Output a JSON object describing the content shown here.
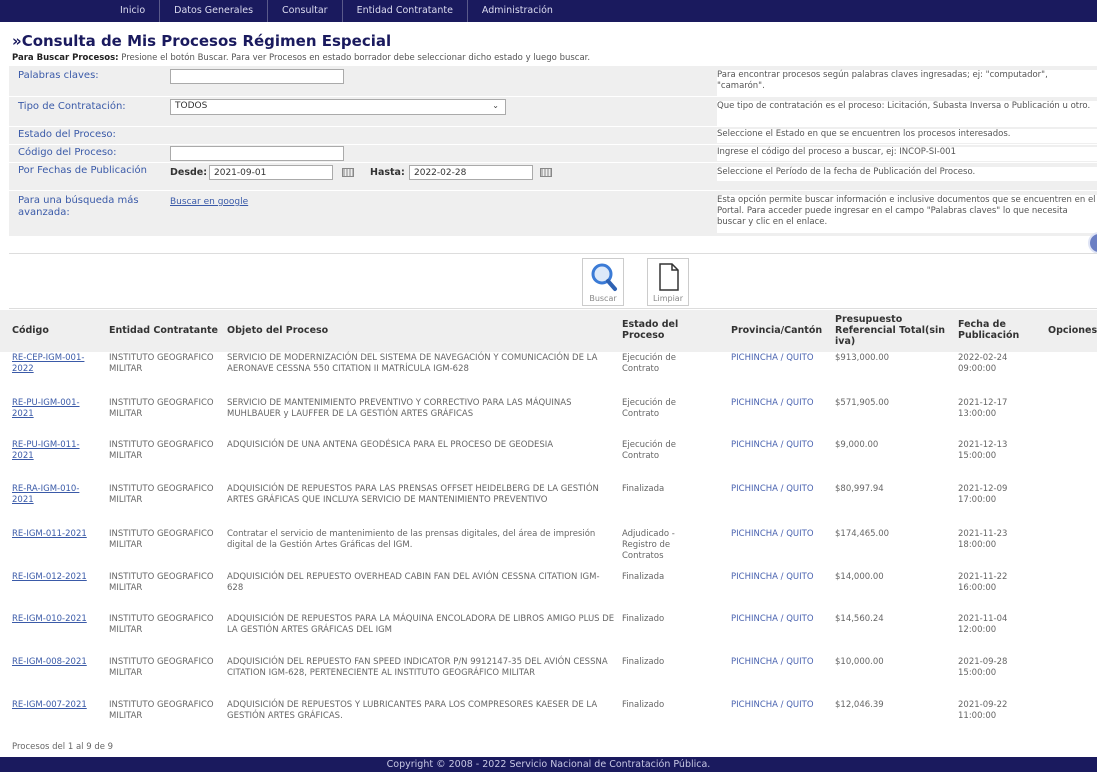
{
  "nav": {
    "items": [
      "Inicio",
      "Datos Generales",
      "Consultar",
      "Entidad Contratante",
      "Administración"
    ]
  },
  "page": {
    "title": "»Consulta de Mis Procesos Régimen Especial",
    "instructions_bold": "Para Buscar Procesos:",
    "instructions_rest": " Presione el botón Buscar. Para ver Procesos en estado borrador debe seleccionar dicho estado y luego buscar."
  },
  "form": {
    "keywords": {
      "label": "Palabras claves:",
      "value": "",
      "help": "Para encontrar procesos según palabras claves ingresadas; ej: \"computador\", \"camarón\"."
    },
    "contract_type": {
      "label": "Tipo de Contratación:",
      "selected": "TODOS",
      "help": "Que tipo de contratación es el proceso: Licitación, Subasta Inversa o Publicación u otro."
    },
    "status": {
      "label": "Estado del Proceso:",
      "help": "Seleccione el Estado en que se encuentren los procesos interesados."
    },
    "code": {
      "label": "Código del Proceso:",
      "value": "",
      "help": "Ingrese el código del proceso a buscar, ej: INCOP-SI-001"
    },
    "dates": {
      "label": "Por Fechas de Publicación",
      "from_label": "Desde:",
      "from_value": "2021-09-01",
      "to_label": "Hasta:",
      "to_value": "2022-02-28",
      "help": "Seleccione el Período de la fecha de Publicación del Proceso."
    },
    "advanced": {
      "label": "Para una búsqueda más avanzada:",
      "link": "Buscar en google",
      "help": "Esta opción permite buscar información e inclusive documentos que se encuentren en el Portal. Para acceder puede ingresar en el campo \"Palabras claves\" lo que necesita buscar y clic en el enlace."
    }
  },
  "buttons": {
    "search": "Buscar",
    "clear": "Limpiar"
  },
  "table": {
    "headers": {
      "code": "Código",
      "entity": "Entidad Contratante",
      "object": "Objeto del Proceso",
      "status": "Estado del Proceso",
      "province": "Provincia/Cantón",
      "budget": "Presupuesto Referencial Total(sin iva)",
      "date": "Fecha de Publicación",
      "options": "Opciones"
    },
    "rows": [
      {
        "code": "RE-CEP-IGM-001-2022",
        "entity": "INSTITUTO GEOGRAFICO MILITAR",
        "object": "SERVICIO DE MODERNIZACIÓN DEL SISTEMA DE NAVEGACIÓN Y COMUNICACIÓN DE LA AERONAVE CESSNA 550 CITATION II MATRÍCULA IGM-628",
        "status": "Ejecución de Contrato",
        "province": "PICHINCHA / QUITO",
        "budget": "$913,000.00",
        "date": "2022-02-24 09:00:00"
      },
      {
        "code": "RE-PU-IGM-001-2021",
        "entity": "INSTITUTO GEOGRAFICO MILITAR",
        "object": "SERVICIO DE MANTENIMIENTO PREVENTIVO Y CORRECTIVO PARA LAS MÁQUINAS MUHLBAUER y LAUFFER DE LA GESTIÓN ARTES GRÁFICAS",
        "status": "Ejecución de Contrato",
        "province": "PICHINCHA / QUITO",
        "budget": "$571,905.00",
        "date": "2021-12-17 13:00:00"
      },
      {
        "code": "RE-PU-IGM-011-2021",
        "entity": "INSTITUTO GEOGRAFICO MILITAR",
        "object": "ADQUISICIÓN DE UNA ANTENA GEODÉSICA PARA EL PROCESO DE GEODESIA",
        "status": "Ejecución de Contrato",
        "province": "PICHINCHA / QUITO",
        "budget": "$9,000.00",
        "date": "2021-12-13 15:00:00"
      },
      {
        "code": "RE-RA-IGM-010-2021",
        "entity": "INSTITUTO GEOGRAFICO MILITAR",
        "object": "ADQUISICIÓN DE REPUESTOS PARA LAS PRENSAS OFFSET HEIDELBERG DE LA GESTIÓN ARTES GRÁFICAS QUE INCLUYA SERVICIO DE MANTENIMIENTO PREVENTIVO",
        "status": "Finalizada",
        "province": "PICHINCHA / QUITO",
        "budget": "$80,997.94",
        "date": "2021-12-09 17:00:00"
      },
      {
        "code": "RE-IGM-011-2021",
        "entity": "INSTITUTO GEOGRAFICO MILITAR",
        "object": "Contratar el servicio de mantenimiento de las prensas digitales, del área de impresión digital de la Gestión Artes Gráficas del IGM.",
        "status": "Adjudicado - Registro de Contratos",
        "province": "PICHINCHA / QUITO",
        "budget": "$174,465.00",
        "date": "2021-11-23 18:00:00"
      },
      {
        "code": "RE-IGM-012-2021",
        "entity": "INSTITUTO GEOGRAFICO MILITAR",
        "object": "ADQUISICIÓN DEL REPUESTO OVERHEAD CABIN FAN DEL AVIÓN CESSNA CITATION IGM-628",
        "status": "Finalizada",
        "province": "PICHINCHA / QUITO",
        "budget": "$14,000.00",
        "date": "2021-11-22 16:00:00"
      },
      {
        "code": "RE-IGM-010-2021",
        "entity": "INSTITUTO GEOGRAFICO MILITAR",
        "object": "ADQUISICIÓN DE REPUESTOS PARA LA MÁQUINA ENCOLADORA DE LIBROS AMIGO PLUS DE LA GESTIÓN ARTES GRÁFICAS DEL IGM",
        "status": "Finalizado",
        "province": "PICHINCHA / QUITO",
        "budget": "$14,560.24",
        "date": "2021-11-04 12:00:00"
      },
      {
        "code": "RE-IGM-008-2021",
        "entity": "INSTITUTO GEOGRAFICO MILITAR",
        "object": "ADQUISICIÓN DEL REPUESTO FAN SPEED INDICATOR P/N 9912147-35 DEL AVIÓN CESSNA CITATION IGM-628, PERTENECIENTE AL INSTITUTO GEOGRÁFICO MILITAR",
        "status": "Finalizado",
        "province": "PICHINCHA / QUITO",
        "budget": "$10,000.00",
        "date": "2021-09-28 15:00:00"
      },
      {
        "code": "RE-IGM-007-2021",
        "entity": "INSTITUTO GEOGRAFICO MILITAR",
        "object": "ADQUISICIÓN DE REPUESTOS Y LUBRICANTES PARA LOS COMPRESORES KAESER DE LA GESTIÓN ARTES GRÁFICAS.",
        "status": "Finalizado",
        "province": "PICHINCHA / QUITO",
        "budget": "$12,046.39",
        "date": "2021-09-22 11:00:00"
      }
    ]
  },
  "footer": {
    "count": "Procesos del 1 al 9 de 9",
    "copyright": "Copyright © 2008 - 2022 Servicio Nacional de Contratación Pública."
  },
  "colors": {
    "nav_bg": "#1a1a5e",
    "label_blue": "#3a5aa8",
    "form_bg": "#efefef"
  }
}
